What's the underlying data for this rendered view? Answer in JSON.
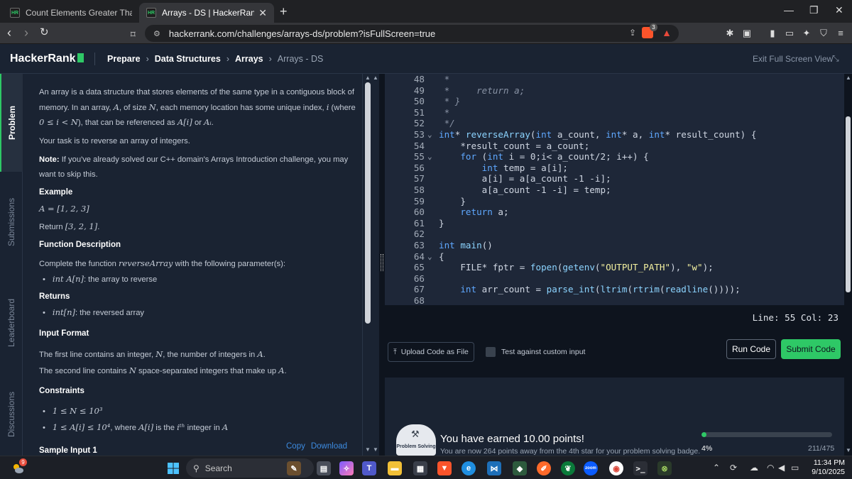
{
  "browser": {
    "tabs": [
      {
        "title": "Count Elements Greater Than Previou",
        "favicon": "HR"
      },
      {
        "title": "Arrays - DS | HackerRank",
        "favicon": "HR"
      }
    ],
    "url": "hackerrank.com/challenges/arrays-ds/problem?isFullScreen=true",
    "brave_badge_count": "3"
  },
  "header": {
    "logo": "HackerRank",
    "breadcrumbs": [
      "Prepare",
      "Data Structures",
      "Arrays",
      "Arrays - DS"
    ],
    "exit_fullscreen": "Exit Full Screen View"
  },
  "vtabs": [
    "Problem",
    "Submissions",
    "Leaderboard",
    "Discussions"
  ],
  "problem": {
    "intro1": "An array is a data structure that stores elements of the same type in a contiguous block of",
    "intro2a": "memory. In an array, ",
    "intro2b": "A",
    "intro2c": ", of size ",
    "intro2d": "N",
    "intro2e": ", each memory location has some unique index, ",
    "intro2f": "i",
    "intro2g": " (where",
    "intro3a": "0 ≤ i < N",
    "intro3b": "), that can be referenced as ",
    "intro3c": "A[i]",
    "intro3d": " or ",
    "intro3e": "Aᵢ",
    "intro3f": ".",
    "task": "Your task is to reverse an array of integers.",
    "note_label": "Note:",
    "note1": " If you've already solved our C++ domain's Arrays Introduction challenge, you may",
    "note2": "want to skip this.",
    "example_heading": "Example",
    "example_array": "A = [1, 2, 3]",
    "return_a": "Return ",
    "return_b": "[3, 2, 1]",
    "return_c": ".",
    "func_heading": "Function Description",
    "func_text_a": "Complete the function ",
    "func_text_b": "reverseArray",
    "func_text_c": " with the following parameter(s):",
    "param_a": "int A[n]",
    "param_b": ": the array to reverse",
    "returns_heading": "Returns",
    "returns_a": "int[n]",
    "returns_b": ": the reversed array",
    "input_heading": "Input Format",
    "input1a": "The first line contains an integer, ",
    "input1b": "N",
    "input1c": ", the number of integers in ",
    "input1d": "A",
    "input1e": ".",
    "input2a": "The second line contains ",
    "input2b": "N",
    "input2c": " space-separated integers that make up ",
    "input2d": "A",
    "input2e": ".",
    "constraints_heading": "Constraints",
    "c1": "1 ≤ N ≤ 10³",
    "c2a": "1 ≤ A[i] ≤ 10⁴",
    "c2b": ", where ",
    "c2c": "A[i]",
    "c2d": " is the ",
    "c2e": "iᵗʰ",
    "c2f": " integer in ",
    "c2g": "A",
    "sample_heading": "Sample Input 1",
    "copy": "Copy",
    "download": "Download"
  },
  "editor": {
    "lines": [
      {
        "n": "48",
        "fold": "",
        "html": "<span class=\"cm\"> *</span>"
      },
      {
        "n": "49",
        "fold": "",
        "html": "<span class=\"cm\"> *     return a;</span>"
      },
      {
        "n": "50",
        "fold": "",
        "html": "<span class=\"cm\"> * }</span>"
      },
      {
        "n": "51",
        "fold": "",
        "html": "<span class=\"cm\"> *</span>"
      },
      {
        "n": "52",
        "fold": "",
        "html": "<span class=\"cm\"> */</span>"
      },
      {
        "n": "53",
        "fold": "v",
        "html": "<span class=\"kw\">int</span>* <span class=\"fn\">reverseArray</span>(<span class=\"kw\">int</span> a_count, <span class=\"kw\">int</span>* a, <span class=\"kw\">int</span>* result_count) {"
      },
      {
        "n": "54",
        "fold": "",
        "html": "    *result_count = a_count;"
      },
      {
        "n": "55",
        "fold": "v",
        "html": "    <span class=\"kw\">for</span> (<span class=\"kw\">int</span> i = 0;i&lt; a_count/2; i++) {"
      },
      {
        "n": "56",
        "fold": "",
        "html": "        <span class=\"kw\">int</span> temp = a[i];"
      },
      {
        "n": "57",
        "fold": "",
        "html": "        a[i] = a[a_count -1 -i];"
      },
      {
        "n": "58",
        "fold": "",
        "html": "        a[a_count -1 -i] = temp;"
      },
      {
        "n": "59",
        "fold": "",
        "html": "    }"
      },
      {
        "n": "60",
        "fold": "",
        "html": "    <span class=\"kw\">return</span> a;"
      },
      {
        "n": "61",
        "fold": "",
        "html": "}"
      },
      {
        "n": "62",
        "fold": "",
        "html": ""
      },
      {
        "n": "63",
        "fold": "",
        "html": "<span class=\"kw\">int</span> <span class=\"fn\">main</span>()"
      },
      {
        "n": "64",
        "fold": "v",
        "html": "{"
      },
      {
        "n": "65",
        "fold": "",
        "html": "    FILE* fptr = <span class=\"fn\">fopen</span>(<span class=\"fn\">getenv</span>(<span class=\"str\">\"OUTPUT_PATH\"</span>), <span class=\"str\">\"w\"</span>);"
      },
      {
        "n": "66",
        "fold": "",
        "html": ""
      },
      {
        "n": "67",
        "fold": "",
        "html": "    <span class=\"kw\">int</span> arr_count = <span class=\"fn\">parse_int</span>(<span class=\"fn\">ltrim</span>(<span class=\"fn\">rtrim</span>(<span class=\"fn\">readline</span>())));"
      },
      {
        "n": "68",
        "fold": "",
        "html": ""
      }
    ],
    "status": "Line: 55 Col: 23"
  },
  "actions": {
    "upload": "Upload Code as File",
    "custom_input": "Test against custom input",
    "run": "Run Code",
    "submit": "Submit Code"
  },
  "result": {
    "badge_label": "Problem Solving",
    "earned": "You have earned 10.00 points!",
    "away": "You are now 264 points away from the 4th star for your problem solving badge.",
    "percent_label": "4%",
    "progress": 0.04,
    "points": "211/475"
  },
  "taskbar": {
    "search": "Search",
    "weather_badge": "9",
    "time": "11:34 PM",
    "date": "9/10/2025"
  },
  "colors": {
    "accent": "#2ec866",
    "link": "#3d8be0",
    "bg": "#0e141e",
    "panel": "#1a2332"
  }
}
